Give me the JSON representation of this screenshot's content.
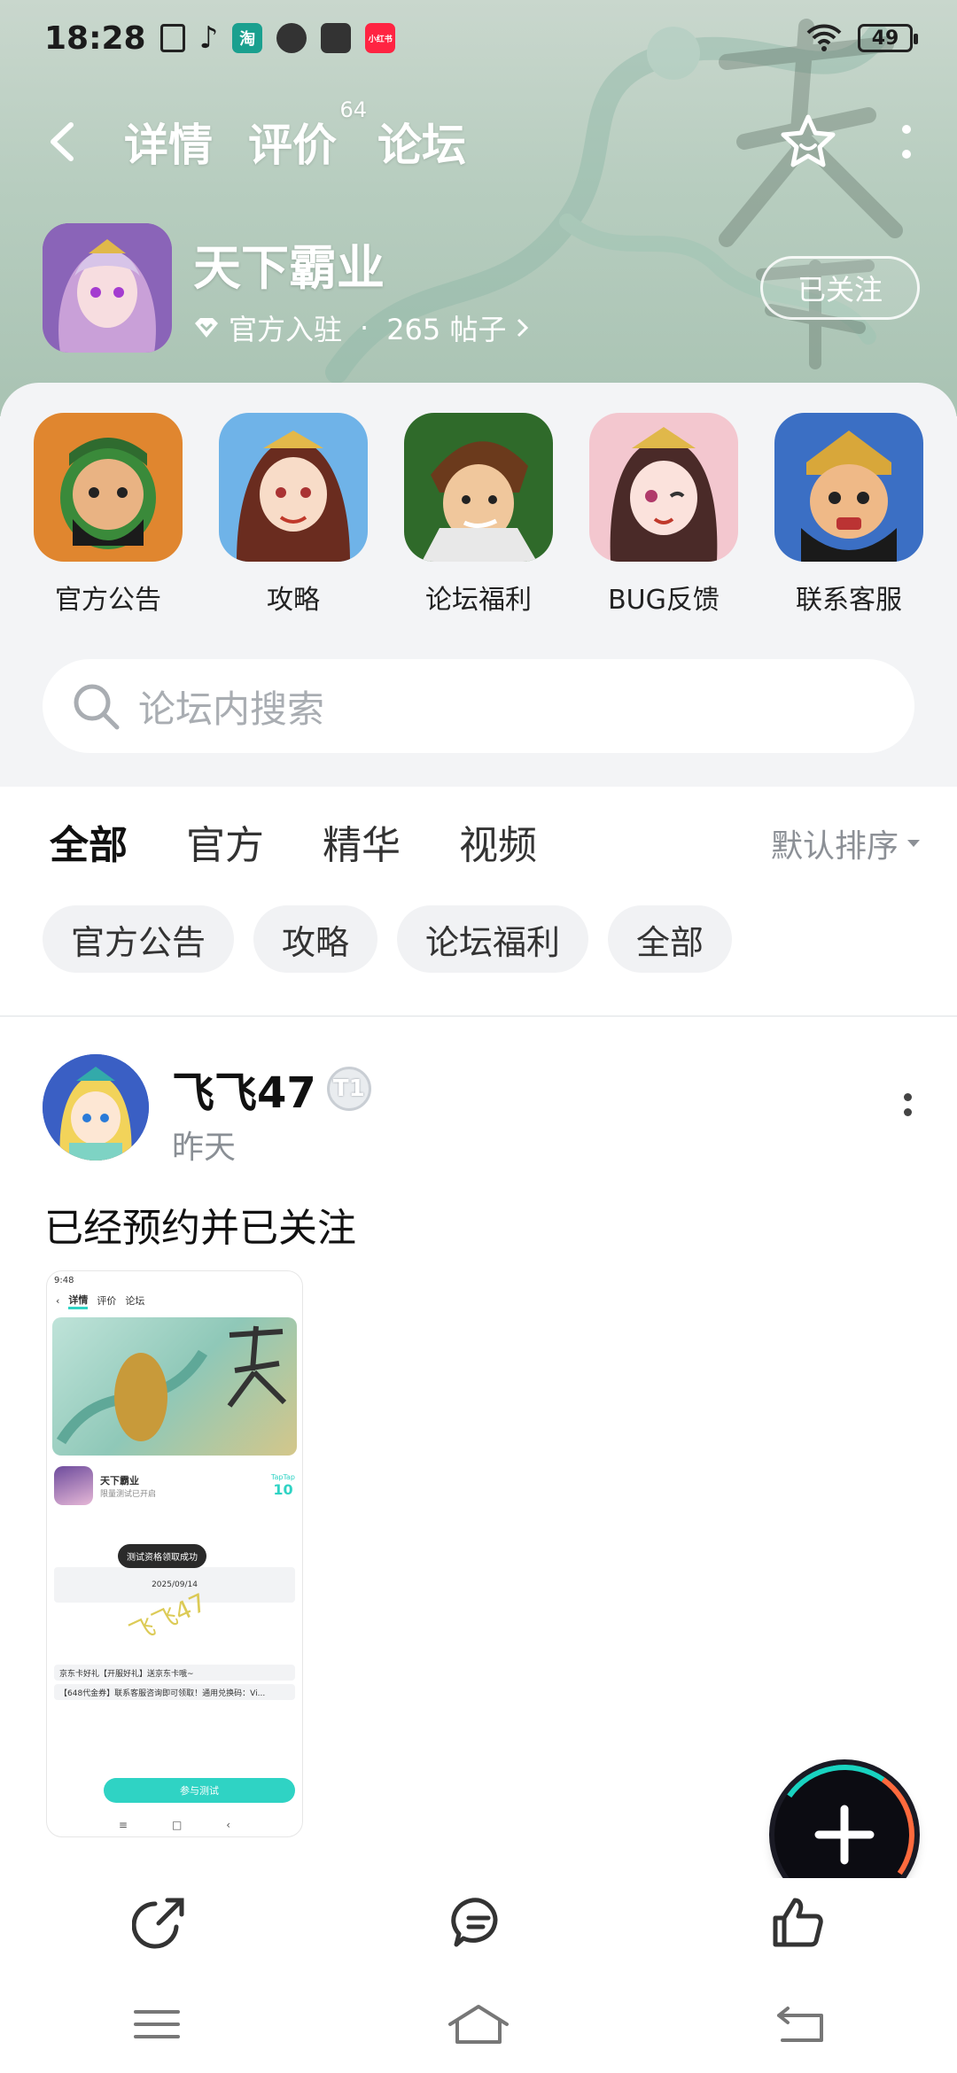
{
  "status_bar": {
    "time": "18:28",
    "app_icons": [
      "document-icon",
      "tiktok-icon",
      "taobao-icon",
      "qq-icon",
      "book-icon",
      "xiaohongshu-icon"
    ],
    "taobao_text": "淘",
    "xhs_text": "小红书",
    "battery": "49"
  },
  "nav": {
    "tabs": [
      {
        "label": "详情"
      },
      {
        "label": "评价",
        "badge": "64"
      },
      {
        "label": "论坛"
      }
    ],
    "active_tab": "论坛"
  },
  "game": {
    "title": "天下霸业",
    "verified": "官方入驻",
    "separator": "·",
    "posts": "265 帖子",
    "follow_label": "已关注"
  },
  "shortcuts": [
    {
      "label": "官方公告"
    },
    {
      "label": "攻略"
    },
    {
      "label": "论坛福利"
    },
    {
      "label": "BUG反馈"
    },
    {
      "label": "联系客服"
    }
  ],
  "search": {
    "placeholder": "论坛内搜索"
  },
  "filter_tabs": [
    {
      "label": "全部"
    },
    {
      "label": "官方"
    },
    {
      "label": "精华"
    },
    {
      "label": "视频"
    }
  ],
  "sort_label": "默认排序",
  "chips": [
    {
      "label": "官方公告"
    },
    {
      "label": "攻略"
    },
    {
      "label": "论坛福利"
    },
    {
      "label": "全部"
    }
  ],
  "post": {
    "author": "飞飞47",
    "level_badge": "T1",
    "time": "昨天",
    "text": "已经预约并已关注",
    "screenshot": {
      "time": "9:48",
      "tab_detail": "详情",
      "tab_review": "评价",
      "tab_forum": "论坛",
      "game": "天下霸业",
      "game_sub": "限量测试已开启",
      "rank_brand": "TapTap",
      "rank": "10",
      "toast": "测试资格领取成功",
      "date": "2025/09/14",
      "event1": "京东卡好礼【开服好礼】送京东卡哦~",
      "event2": "【648代金券】联系客服咨询即可领取！通用兑换码：Vi...",
      "watermark": "飞飞47",
      "cta": "参与测试"
    }
  },
  "colors": {
    "accent": "#17c3b2",
    "muted": "#8a8f95",
    "panel": "#f3f4f6"
  }
}
